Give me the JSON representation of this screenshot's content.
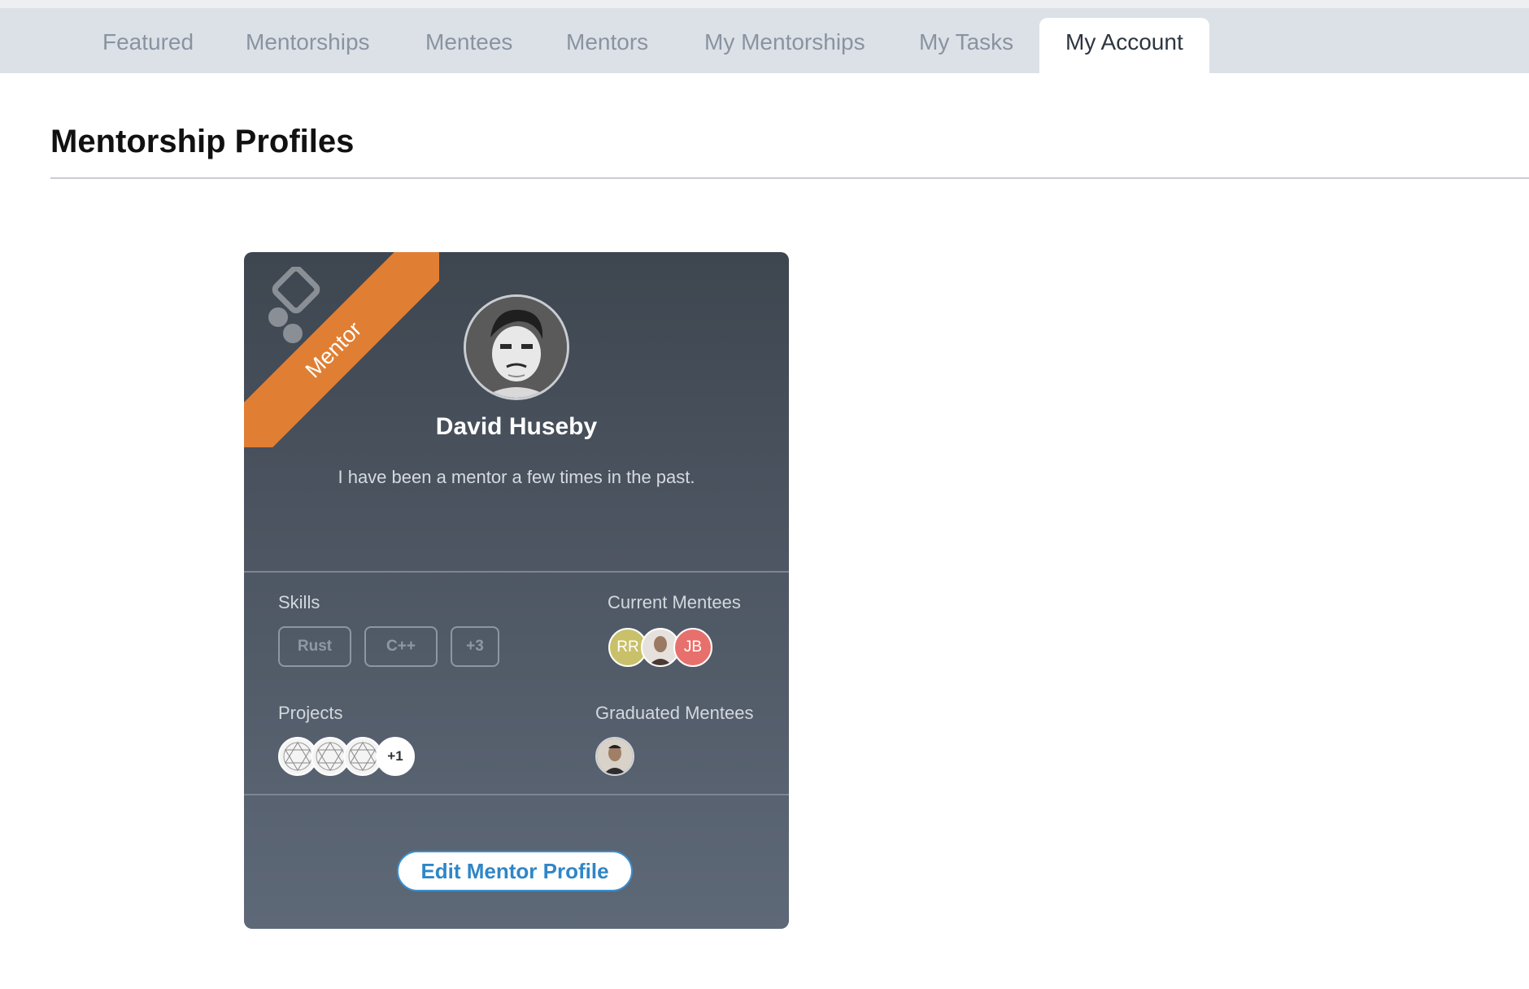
{
  "tabs": [
    {
      "label": "Featured"
    },
    {
      "label": "Mentorships"
    },
    {
      "label": "Mentees"
    },
    {
      "label": "Mentors"
    },
    {
      "label": "My Mentorships"
    },
    {
      "label": "My Tasks"
    },
    {
      "label": "My Account"
    }
  ],
  "active_tab": "My Account",
  "page": {
    "title": "Mentorship Profiles"
  },
  "card": {
    "ribbon": "Mentor",
    "name": "David Huseby",
    "bio": "I have been a mentor a few times in the past.",
    "skills_label": "Skills",
    "skills": [
      "Rust",
      "C++",
      "+3"
    ],
    "current_mentees_label": "Current Mentees",
    "current_mentees": [
      {
        "initials": "RR",
        "color": "#c9c06a"
      },
      {
        "initials": "",
        "color": "#8a6d5a"
      },
      {
        "initials": "JB",
        "color": "#e8706c"
      }
    ],
    "projects_label": "Projects",
    "projects_more": "+1",
    "graduated_mentees_label": "Graduated Mentees",
    "edit_button": "Edit Mentor Profile"
  },
  "colors": {
    "accent": "#e07f33",
    "button": "#2f86c7",
    "card_bg": "#4d5662"
  }
}
